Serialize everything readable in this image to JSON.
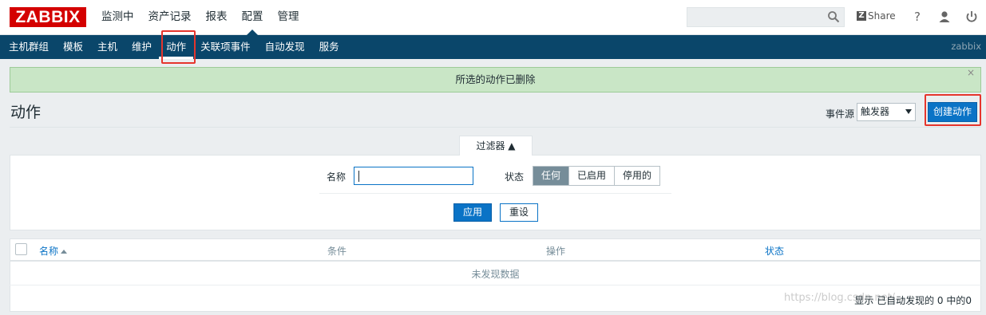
{
  "header": {
    "logo": "ZABBIX",
    "menu": [
      "监测中",
      "资产记录",
      "报表",
      "配置",
      "管理"
    ],
    "active_menu": "配置",
    "share": "Share",
    "help": "?",
    "search_placeholder": ""
  },
  "subnav": {
    "items": [
      "主机群组",
      "模板",
      "主机",
      "维护",
      "动作",
      "关联项事件",
      "自动发现",
      "服务"
    ],
    "active": "动作",
    "user": "zabbix"
  },
  "message": {
    "text": "所选的动作已删除",
    "close": "×"
  },
  "page": {
    "title": "动作",
    "event_source_label": "事件源",
    "event_source_value": "触发器",
    "create_button": "创建动作"
  },
  "filter": {
    "tab_label": "过滤器 ▲",
    "name_label": "名称",
    "name_value": "",
    "status_label": "状态",
    "status_options": [
      "任何",
      "已启用",
      "停用的"
    ],
    "status_selected": "任何",
    "apply_button": "应用",
    "reset_button": "重设"
  },
  "table": {
    "columns": [
      "名称",
      "条件",
      "操作",
      "状态"
    ],
    "sorted_column": "名称",
    "sort_direction": "ascending",
    "empty_text": "未发现数据",
    "footer": "显示 已自动发现的 0 中的0"
  },
  "watermark": "https://blog.csdn.net/...",
  "colors": {
    "brand": "#d40000",
    "nav": "#0a466a",
    "accent": "#0a73c6",
    "success_bg": "#c9e6c6",
    "highlight": "#e5352d"
  }
}
